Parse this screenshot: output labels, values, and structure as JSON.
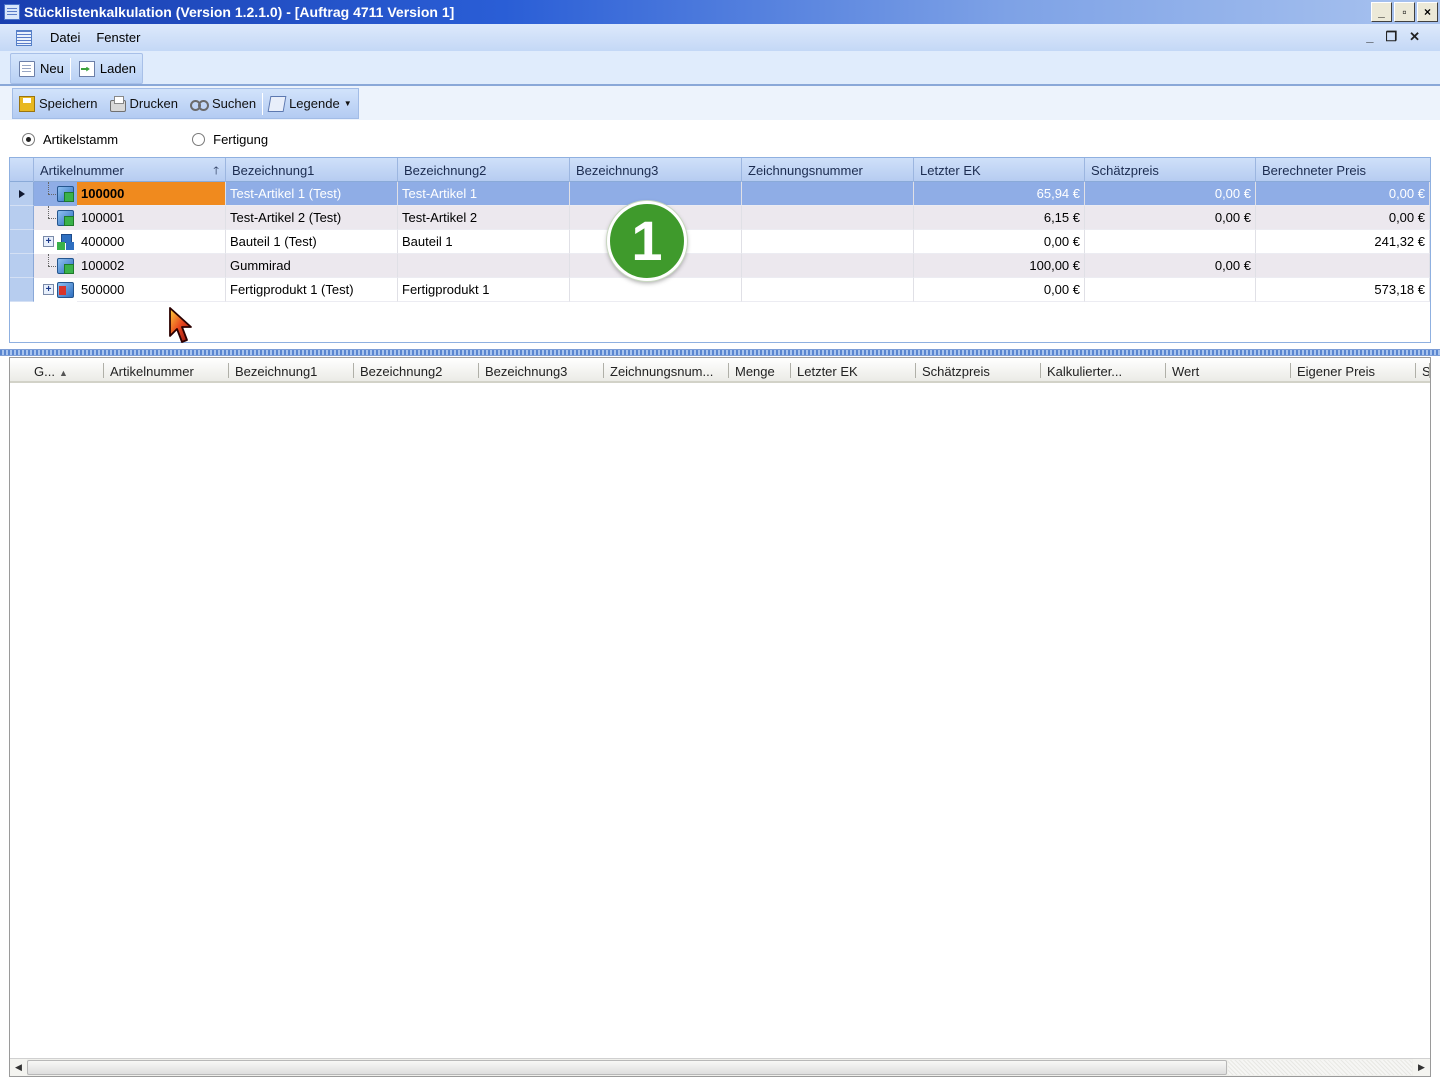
{
  "window": {
    "title": "Stücklistenkalkulation (Version 1.2.1.0) - [Auftrag 4711 Version 1]",
    "controls": [
      "_",
      "▫",
      "×"
    ]
  },
  "menu": {
    "items": [
      "Datei",
      "Fenster"
    ],
    "mdi_controls": [
      "_",
      "❐",
      "✕"
    ]
  },
  "toolbar_main": {
    "new_label": "Neu",
    "load_label": "Laden"
  },
  "toolbar_doc": {
    "save_label": "Speichern",
    "print_label": "Drucken",
    "search_label": "Suchen",
    "legend_label": "Legende"
  },
  "mode": {
    "option1": "Artikelstamm",
    "option2": "Fertigung",
    "selected": "Artikelstamm"
  },
  "articles": {
    "columns": [
      "Artikelnummer",
      "Bezeichnung1",
      "Bezeichnung2",
      "Bezeichnung3",
      "Zeichnungsnummer",
      "Letzter EK",
      "Schätzpreis",
      "Berechneter Preis"
    ],
    "sort_column": "Artikelnummer",
    "rows": [
      {
        "nr": "100000",
        "b1": "Test-Artikel 1  (Test)",
        "b2": "Test-Artikel 1",
        "b3": "",
        "zn": "",
        "ek": "65,94 €",
        "sp": "0,00 €",
        "bp": "0,00 €",
        "icon": "article-icon"
      },
      {
        "nr": "100001",
        "b1": "Test-Artikel 2  (Test)",
        "b2": "Test-Artikel 2",
        "b3": "",
        "zn": "",
        "ek": "6,15 €",
        "sp": "0,00 €",
        "bp": "0,00 €",
        "icon": "article-icon"
      },
      {
        "nr": "400000",
        "b1": "Bauteil 1  (Test)",
        "b2": "Bauteil 1",
        "b3": "",
        "zn": "",
        "ek": "0,00 €",
        "sp": "",
        "bp": "241,32 €",
        "icon": "assembly-icon"
      },
      {
        "nr": "100002",
        "b1": "Gummirad",
        "b2": "",
        "b3": "",
        "zn": "",
        "ek": "100,00 €",
        "sp": "0,00 €",
        "bp": "",
        "icon": "article-icon"
      },
      {
        "nr": "500000",
        "b1": "Fertigprodukt 1  (Test)",
        "b2": "Fertigprodukt 1",
        "b3": "",
        "zn": "",
        "ek": "0,00 €",
        "sp": "",
        "bp": "573,18 €",
        "icon": "product-icon"
      }
    ]
  },
  "callout": {
    "number": "1"
  },
  "bom": {
    "columns": [
      "G...",
      "Artikelnummer",
      "Bezeichnung1",
      "Bezeichnung2",
      "Bezeichnung3",
      "Zeichnungsnum...",
      "Menge",
      "Letzter EK",
      "Schätzpreis",
      "Kalkulierter...",
      "Wert",
      "Eigener Preis",
      "S"
    ]
  },
  "colors": {
    "selected_row": "#8fade6",
    "selected_cell": "#f08a1e",
    "callout": "#3f9a2c"
  }
}
